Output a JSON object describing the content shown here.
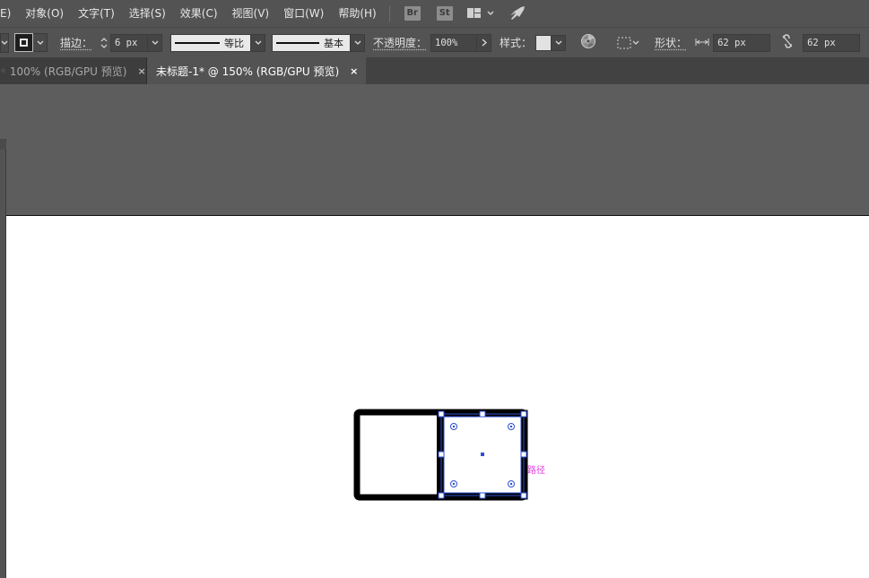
{
  "menubar": {
    "items": [
      {
        "label": "E)",
        "name": "menu-edit-partial"
      },
      {
        "label": "对象(O)",
        "name": "menu-object"
      },
      {
        "label": "文字(T)",
        "name": "menu-type"
      },
      {
        "label": "选择(S)",
        "name": "menu-select"
      },
      {
        "label": "效果(C)",
        "name": "menu-effect"
      },
      {
        "label": "视图(V)",
        "name": "menu-view"
      },
      {
        "label": "窗口(W)",
        "name": "menu-window"
      },
      {
        "label": "帮助(H)",
        "name": "menu-help"
      }
    ],
    "bridge_badge": "Br",
    "stock_badge": "St"
  },
  "controlbar": {
    "stroke_label": "描边：",
    "stroke_weight": "6 px",
    "profile_label": "等比",
    "brush_label": "基本",
    "opacity_label": "不透明度：",
    "opacity_value": "100%",
    "style_label": "样式：",
    "shape_label": "形状：",
    "width_value": "62 px",
    "height_value": "62 px"
  },
  "tabs": [
    {
      "label": "100% (RGB/GPU 预览)",
      "active": false
    },
    {
      "label": "未标题-1* @ 150% (RGB/GPU 预览)",
      "active": true
    }
  ],
  "tab_close_glyph": "×",
  "canvas": {
    "smart_guide_label": "路径",
    "selection_color": "#2c4fd6",
    "guide_label_color": "#e03fe0"
  }
}
